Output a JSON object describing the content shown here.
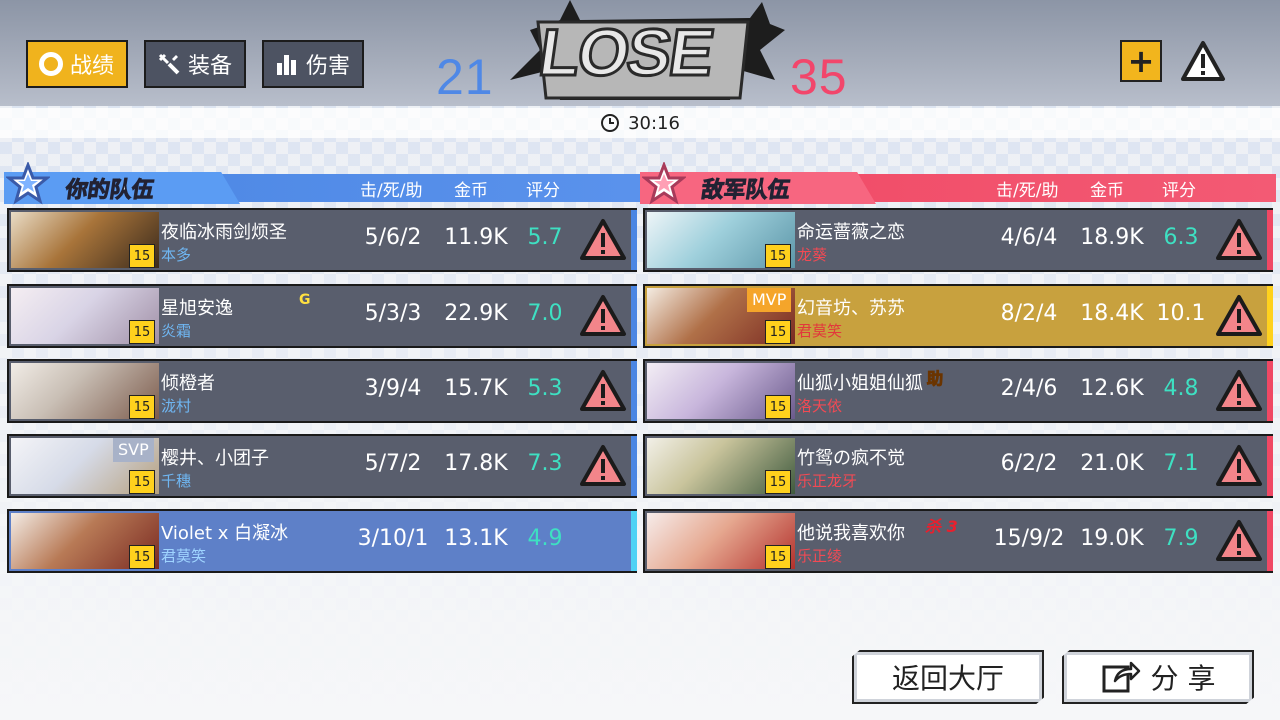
{
  "header": {
    "tabs": [
      {
        "label": "战绩",
        "icon": "ring-icon",
        "active": true
      },
      {
        "label": "装备",
        "icon": "tools-icon",
        "active": false
      },
      {
        "label": "伤害",
        "icon": "bar-chart-icon",
        "active": false
      }
    ],
    "score_blue": "21",
    "score_red": "35",
    "result_text": "LOSE",
    "plus_label": "+",
    "timer": "30:16"
  },
  "columns": {
    "kda": "击/死/助",
    "gold": "金币",
    "rating": "评分"
  },
  "my_team": {
    "title": "你的队伍",
    "players": [
      {
        "name": "夜临冰雨剑烦圣",
        "id": "本多",
        "level": "15",
        "kda": "5/6/2",
        "gold": "11.9K",
        "rating": "5.7"
      },
      {
        "name": "星旭安逸",
        "id": "炎霜",
        "level": "15",
        "kda": "5/3/3",
        "gold": "22.9K",
        "rating": "7.0",
        "tag": "G"
      },
      {
        "name": "倾橙者",
        "id": "泷村",
        "level": "15",
        "kda": "3/9/4",
        "gold": "15.7K",
        "rating": "5.3"
      },
      {
        "name": "樱井、小团子",
        "id": "千穗",
        "level": "15",
        "kda": "5/7/2",
        "gold": "17.8K",
        "rating": "7.3",
        "badge": "SVP"
      },
      {
        "name": "Violet x 白凝冰",
        "id": "君莫笑",
        "level": "15",
        "kda": "3/10/1",
        "gold": "13.1K",
        "rating": "4.9"
      }
    ]
  },
  "enemy_team": {
    "title": "敌军队伍",
    "players": [
      {
        "name": "命运蔷薇之恋",
        "id": "龙葵",
        "level": "15",
        "kda": "4/6/4",
        "gold": "18.9K",
        "rating": "6.3"
      },
      {
        "name": "幻音坊、苏苏",
        "id": "君莫笑",
        "level": "15",
        "kda": "8/2/4",
        "gold": "18.4K",
        "rating": "10.1",
        "badge": "MVP"
      },
      {
        "name": "仙狐小姐姐仙狐",
        "id": "洛天依",
        "level": "15",
        "kda": "2/4/6",
        "gold": "12.6K",
        "rating": "4.8",
        "tag": "助"
      },
      {
        "name": "竹鸳の疯不觉",
        "id": "乐正龙牙",
        "level": "15",
        "kda": "6/2/2",
        "gold": "21.0K",
        "rating": "7.1"
      },
      {
        "name": "他说我喜欢你",
        "id": "乐正绫",
        "level": "15",
        "kda": "15/9/2",
        "gold": "19.0K",
        "rating": "7.9",
        "tag": "杀 3"
      }
    ]
  },
  "footer": {
    "back_label": "返回大厅",
    "share_label": "分 享"
  },
  "colors": {
    "blue_team": "#4b86e3",
    "red_team": "#f04864",
    "rating_color": "#3ee0c2",
    "mvp_row": "#c8a13e",
    "active_tab": "#f0b31d"
  }
}
